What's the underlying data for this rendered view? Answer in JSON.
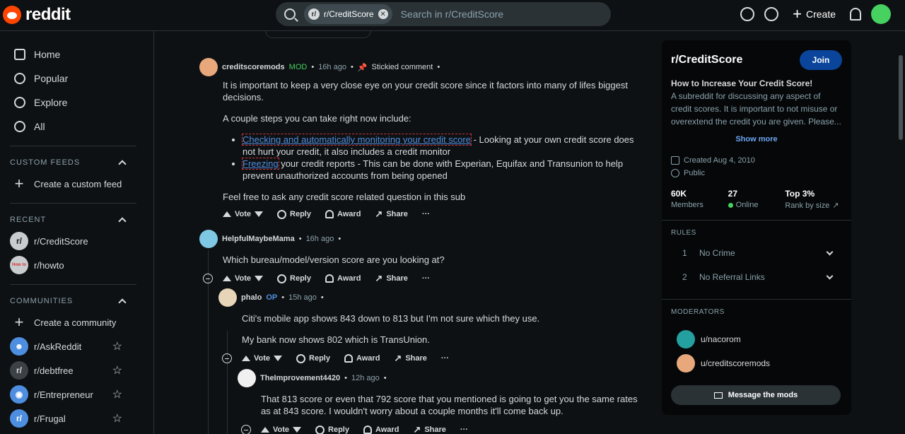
{
  "header": {
    "logo_text": "reddit",
    "search_chip": "r/CreditScore",
    "chip_icon_letter": "r/",
    "search_placeholder": "Search in r/CreditScore",
    "create_label": "Create"
  },
  "sidebar": {
    "nav": [
      "Home",
      "Popular",
      "Explore",
      "All"
    ],
    "custom_feeds_title": "CUSTOM FEEDS",
    "create_custom_feed": "Create a custom feed",
    "recent_title": "RECENT",
    "recent": [
      {
        "name": "r/CreditScore",
        "avatar": "r/"
      },
      {
        "name": "r/howto",
        "avatar": "How to"
      }
    ],
    "communities_title": "COMMUNITIES",
    "create_community": "Create a community",
    "communities": [
      {
        "name": "r/AskReddit",
        "avatar": "☻"
      },
      {
        "name": "r/debtfree",
        "avatar": "r/"
      },
      {
        "name": "r/Entrepreneur",
        "avatar": "◉"
      },
      {
        "name": "r/Frugal",
        "avatar": "r/"
      }
    ]
  },
  "comments": {
    "c1": {
      "author": "creditscoremods",
      "mod_tag": "MOD",
      "time": "16h ago",
      "stickied": "Stickied comment",
      "p1": "It is important to keep a very close eye on your credit score since it factors into many of lifes biggest decisions.",
      "p2": "A couple steps you can take right now include:",
      "li1_link": "Checking and automatically monitoring your credit score",
      "li1_rest": " - Looking at your own credit score does not hurt your credit, it also includes a credit monitor",
      "li2_link": "Freezing",
      "li2_rest": " your credit reports - This can be done with Experian, Equifax and Transunion to help prevent unauthorized accounts from being opened",
      "p3": "Feel free to ask any credit score related question in this sub"
    },
    "c2": {
      "author": "HelpfulMaybeMama",
      "time": "16h ago",
      "body": "Which bureau/model/version score are you looking at?"
    },
    "c3": {
      "author": "phalo",
      "op_tag": "OP",
      "time": "15h ago",
      "p1": "Citi's mobile app shows 843 down to 813 but I'm not sure which they use.",
      "p2": "My bank now shows 802 which is TransUnion."
    },
    "c4": {
      "author": "TheImprovement4420",
      "time": "12h ago",
      "body": "That 813 score or even that 792 score that you mentioned is going to get you the same rates as at 843 score. I wouldn't worry about a couple months it'll come back up."
    }
  },
  "actions": {
    "vote": "Vote",
    "reply": "Reply",
    "award": "Award",
    "share": "Share",
    "more": "···"
  },
  "rightbar": {
    "title": "r/CreditScore",
    "join": "Join",
    "subtitle": "How to Increase Your Credit Score!",
    "description": "A subreddit for discussing any aspect of credit scores. It is important to not misuse or overextend the credit you are given. Please...",
    "show_more": "Show more",
    "created": "Created Aug 4, 2010",
    "visibility": "Public",
    "members_val": "60K",
    "members_lbl": "Members",
    "online_val": "27",
    "online_lbl": "Online",
    "rank_val": "Top 3%",
    "rank_lbl": "Rank by size",
    "rules_title": "RULES",
    "rules": [
      {
        "num": "1",
        "label": "No Crime"
      },
      {
        "num": "2",
        "label": "No Referral Links"
      }
    ],
    "moderators_title": "MODERATORS",
    "moderators": [
      "u/nacorom",
      "u/creditscoremods"
    ],
    "message_mods": "Message the mods"
  },
  "colors": {
    "background": "#0e1113",
    "accent_blue": "#0a449b",
    "link": "#4e8ee0",
    "mod_green": "#46d160",
    "brand": "#ff4500"
  }
}
